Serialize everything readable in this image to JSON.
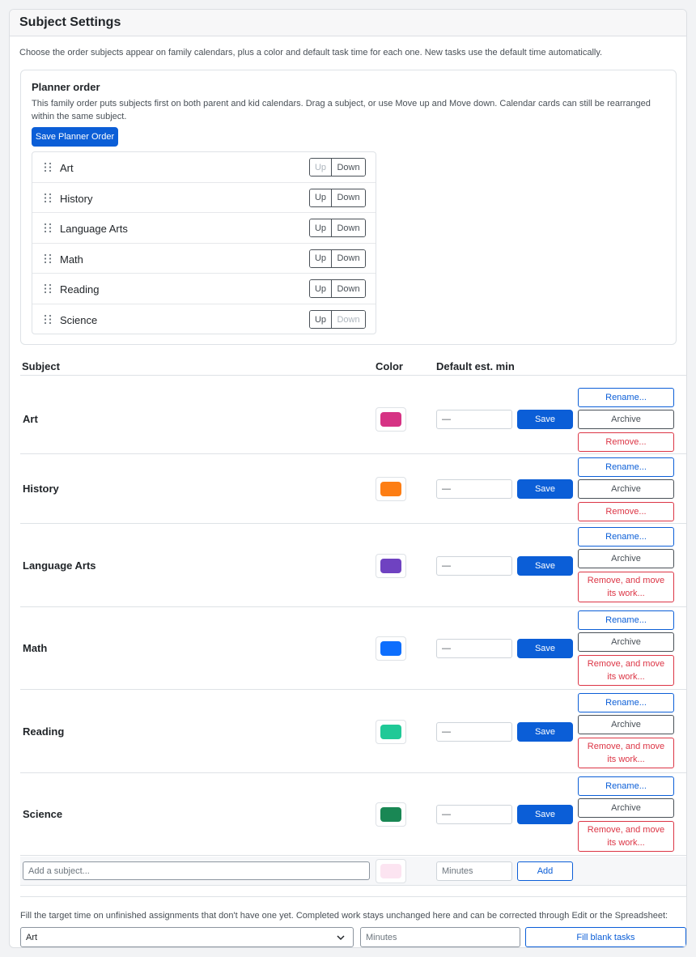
{
  "page": {
    "title": "Subject Settings",
    "intro": "Choose the order subjects appear on family calendars, plus a color and default task time for each one. New tasks use the default time automatically."
  },
  "planner": {
    "title": "Planner order",
    "description": "This family order puts subjects first on both parent and kid calendars. Drag a subject, or use Move up and Move down. Calendar cards can still be rearranged within the same subject.",
    "save_label": "Save Planner Order",
    "up_label": "Up",
    "down_label": "Down",
    "items": [
      {
        "label": "Art"
      },
      {
        "label": "History"
      },
      {
        "label": "Language Arts"
      },
      {
        "label": "Math"
      },
      {
        "label": "Reading"
      },
      {
        "label": "Science"
      }
    ]
  },
  "table": {
    "headers": {
      "subject": "Subject",
      "color": "Color",
      "default_min": "Default est. min"
    },
    "save_label": "Save",
    "rename_label": "Rename...",
    "archive_label": "Archive",
    "rows": [
      {
        "name": "Art",
        "color": "#d63384",
        "minutes": "—",
        "remove_label": "Remove..."
      },
      {
        "name": "History",
        "color": "#fd7e14",
        "minutes": "—",
        "remove_label": "Remove..."
      },
      {
        "name": "Language Arts",
        "color": "#6f42c1",
        "minutes": "—",
        "remove_label": "Remove, and move its work..."
      },
      {
        "name": "Math",
        "color": "#0d6efd",
        "minutes": "—",
        "remove_label": "Remove, and move its work..."
      },
      {
        "name": "Reading",
        "color": "#20c997",
        "minutes": "—",
        "remove_label": "Remove, and move its work..."
      },
      {
        "name": "Science",
        "color": "#198754",
        "minutes": "—",
        "remove_label": "Remove, and move its work..."
      }
    ]
  },
  "add_subject": {
    "placeholder": "Add a subject...",
    "minutes_placeholder": "Minutes",
    "color": "#fce4f1",
    "add_label": "Add"
  },
  "fill": {
    "text": "Fill the target time on unfinished assignments that don't have one yet. Completed work stays unchanged here and can be corrected through Edit or the Spreadsheet:",
    "selected_subject": "Art",
    "minutes_placeholder": "Minutes",
    "button_label": "Fill blank tasks"
  }
}
